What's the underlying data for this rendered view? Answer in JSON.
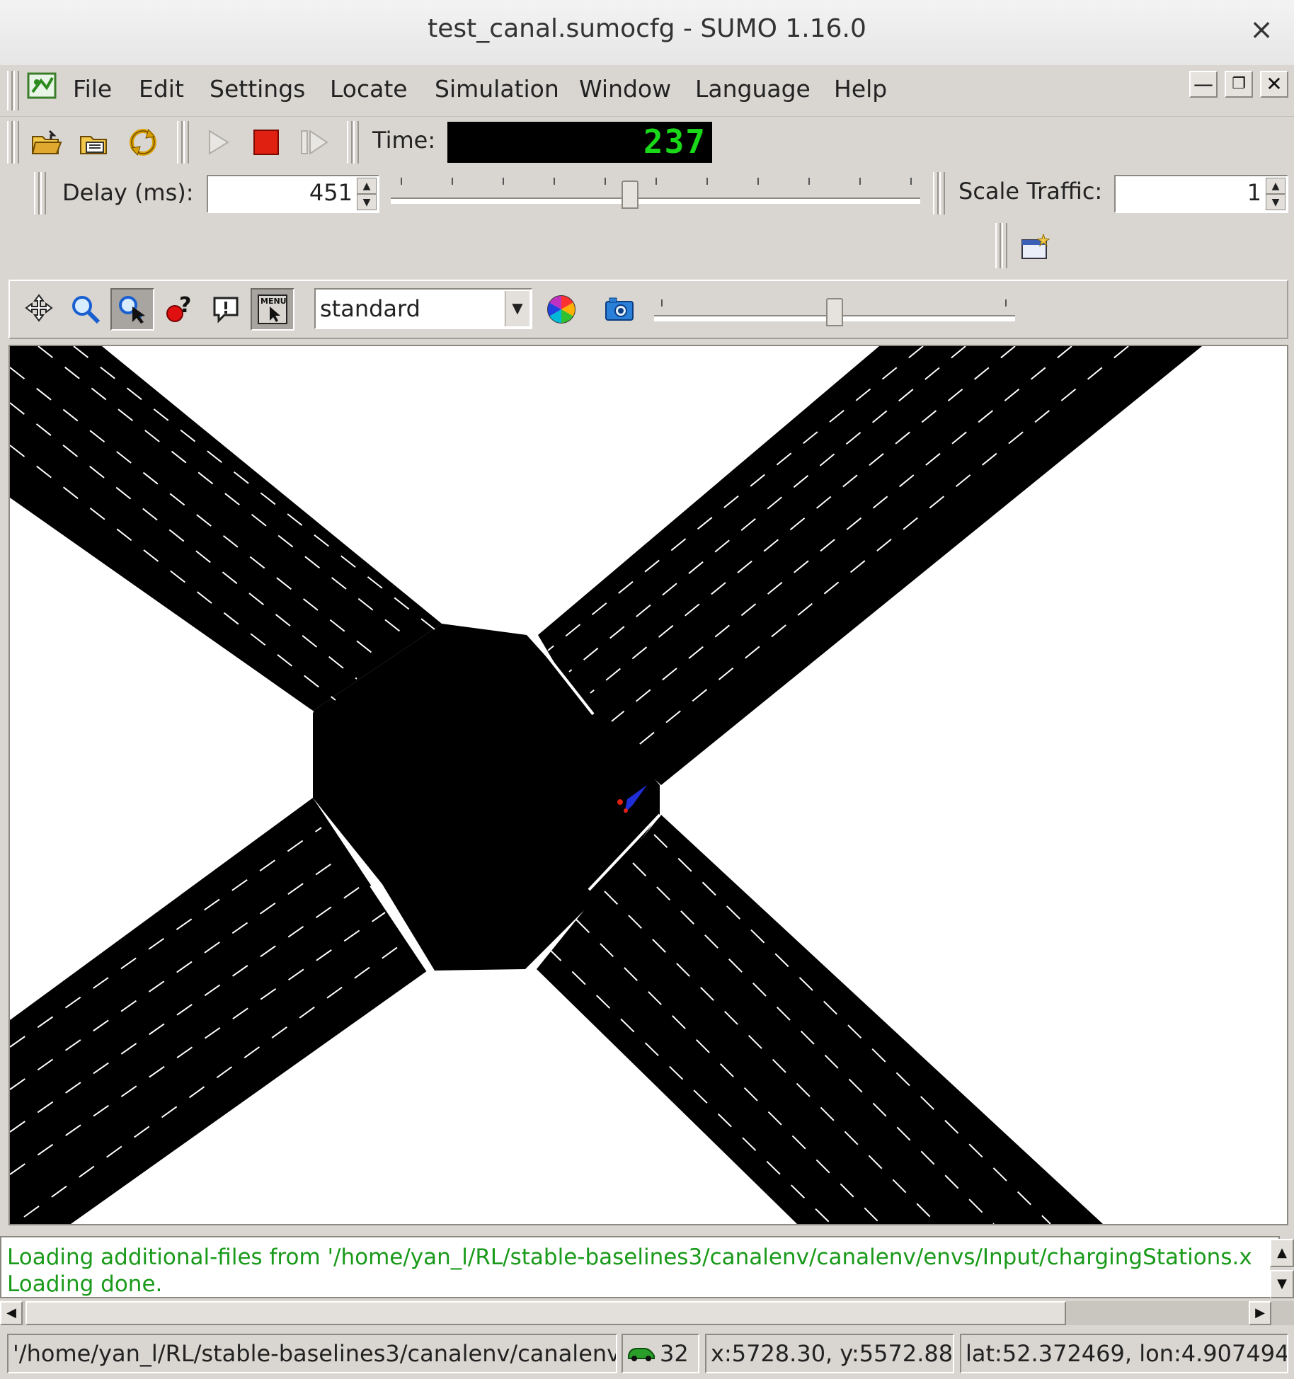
{
  "window": {
    "title": "test_canal.sumocfg - SUMO 1.16.0",
    "close_glyph": "×"
  },
  "menubar": {
    "items": [
      {
        "label": "File",
        "mnemonic": "F"
      },
      {
        "label": "Edit",
        "mnemonic": "E"
      },
      {
        "label": "Settings",
        "mnemonic": "S"
      },
      {
        "label": "Locate",
        "mnemonic": "L"
      },
      {
        "label": "Simulation",
        "mnemonic": ""
      },
      {
        "label": "Window",
        "mnemonic": "W"
      },
      {
        "label": "Language",
        "mnemonic": ""
      },
      {
        "label": "Help",
        "mnemonic": "H"
      }
    ],
    "window_controls": [
      "minimize",
      "restore",
      "close"
    ]
  },
  "toolbar": {
    "time_label": "Time:",
    "time_value": "237",
    "delay_label": "Delay (ms):",
    "delay_value": "451",
    "delay_slider_fraction": 0.45,
    "scale_label": "Scale Traffic:",
    "scale_value": "1",
    "icons": [
      "open-folder-icon",
      "open-network-icon",
      "reload-icon",
      "run-icon",
      "stop-icon",
      "step-icon",
      "new-view-icon"
    ]
  },
  "viewbar": {
    "scheme_selected": "standard",
    "icons": [
      "recenter-icon",
      "zoom-icon",
      "locate-icon",
      "help-cursor-icon",
      "tooltip-icon",
      "menu-icon",
      "color-wheel-icon",
      "screenshot-icon"
    ],
    "slider_fraction": 0.5
  },
  "messages": {
    "lines": [
      "Loading additional-files from '/home/yan_l/RL/stable-baselines3/canalenv/canalenv/envs/Input/chargingStations.x",
      "Loading done."
    ],
    "color": "#1a9a1a"
  },
  "statusbar": {
    "path": "'/home/yan_l/RL/stable-baselines3/canalenv/canalenv",
    "vehicle_count": "32",
    "xy": "x:5728.30, y:5572.88",
    "latlon": "lat:52.372469, lon:4.907494"
  },
  "colors": {
    "road": "#000000",
    "canvas_bg": "#ffffff",
    "lcd_text": "#19d919",
    "vehicle": "#1f2fd8"
  }
}
